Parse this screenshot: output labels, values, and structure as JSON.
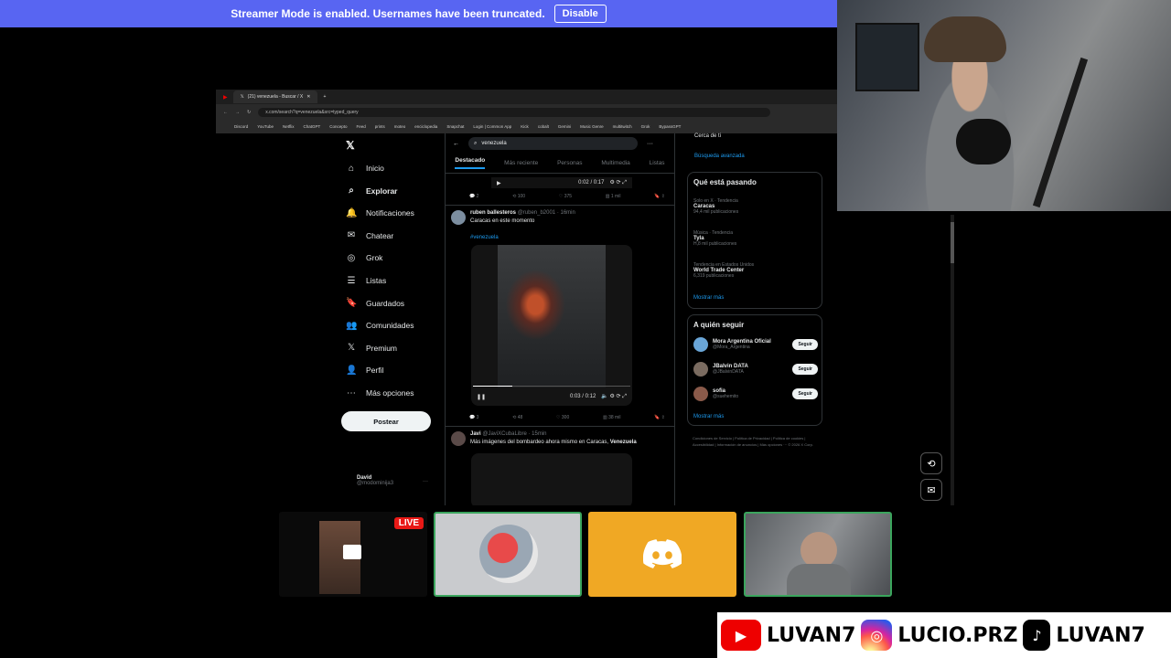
{
  "banner": {
    "text": "Streamer Mode is enabled. Usernames have been truncated.",
    "button": "Disable"
  },
  "browser": {
    "tab_title": "(21) venezuela - Buscar / X",
    "url": "x.com/search?q=venezuela&src=typed_query",
    "bookmarks": [
      "Discord",
      "YouTube",
      "Netflix",
      "ChatGPT",
      "Concepto",
      "Feed",
      "prints",
      "moteo",
      "enciclopedia",
      "Snapchat",
      "Login | Common App",
      "Kick",
      "cobalt",
      "Gemini",
      "Music Genre",
      "multitwitch",
      "Grok",
      "BypassGPT"
    ]
  },
  "nav": {
    "items": [
      "Inicio",
      "Explorar",
      "Notificaciones",
      "Chatear",
      "Grok",
      "Listas",
      "Guardados",
      "Comunidades",
      "Premium",
      "Perfil",
      "Más opciones"
    ],
    "post": "Postear",
    "profile_name": "David",
    "profile_handle": "@modominija3"
  },
  "feed": {
    "search": "venezuela",
    "tabs": [
      "Destacado",
      "Más reciente",
      "Personas",
      "Multimedia",
      "Listas"
    ],
    "top_player_time": "0:02 / 0:17",
    "top_actions": [
      "2",
      "100",
      "375",
      "1 mil"
    ],
    "tweet1": {
      "name": "ruben ballesteros",
      "handle": "@ruben_b2001",
      "time": "· 16min",
      "text": "Caracas en este momento",
      "hashtag": "#venezuela",
      "player_time": "0:03 / 0:12",
      "actions": [
        "3",
        "48",
        "300",
        "38 mil"
      ]
    },
    "tweet2": {
      "name": "Javi",
      "handle": "@JaviXCubaLibre",
      "time": "· 15min",
      "text": "Más imágenes del bombardeo ahora mismo en Caracas,",
      "bold": "Venezuela"
    }
  },
  "side": {
    "top_text": "Cerca de ti",
    "advanced": "Búsqueda avanzada",
    "trending_title": "Qué está pasando",
    "trends": [
      {
        "context": "Solo en X · Tendencia",
        "topic": "Caracas",
        "count": "94,4 mil publicaciones"
      },
      {
        "context": "Música · Tendencia",
        "topic": "Tyla",
        "count": "H,8 mil publicaciones"
      },
      {
        "context": "Tendencia en Estados Unidos",
        "topic": "World Trade Center",
        "count": "6,319 publicaciones"
      }
    ],
    "show_more": "Mostrar más",
    "follow_title": "A quién seguir",
    "follow": [
      {
        "name": "Mora Argentina Oficial",
        "handle": "@Mora_Argentina",
        "btn": "Seguir"
      },
      {
        "name": "JBalvin DATA",
        "handle": "@JBalvinDATA",
        "btn": "Seguir"
      },
      {
        "name": "sofia",
        "handle": "@suehemito",
        "btn": "Seguir"
      }
    ],
    "footer": "Condiciones de Servicio | Política de Privacidad | Política de cookies | Accesibilidad | Información de anuncios | Más opciones ··· © 2026 X Corp."
  },
  "stream": {
    "live": "LIVE"
  },
  "socials": {
    "youtube": "LUVAN7",
    "instagram": "LUCIO.PRZ",
    "tiktok": "LUVAN7"
  },
  "colors": {
    "banner": "#5865f2",
    "discord_tile": "#f0a824",
    "live": "#e91916",
    "x_blue": "#1d9bf0"
  }
}
